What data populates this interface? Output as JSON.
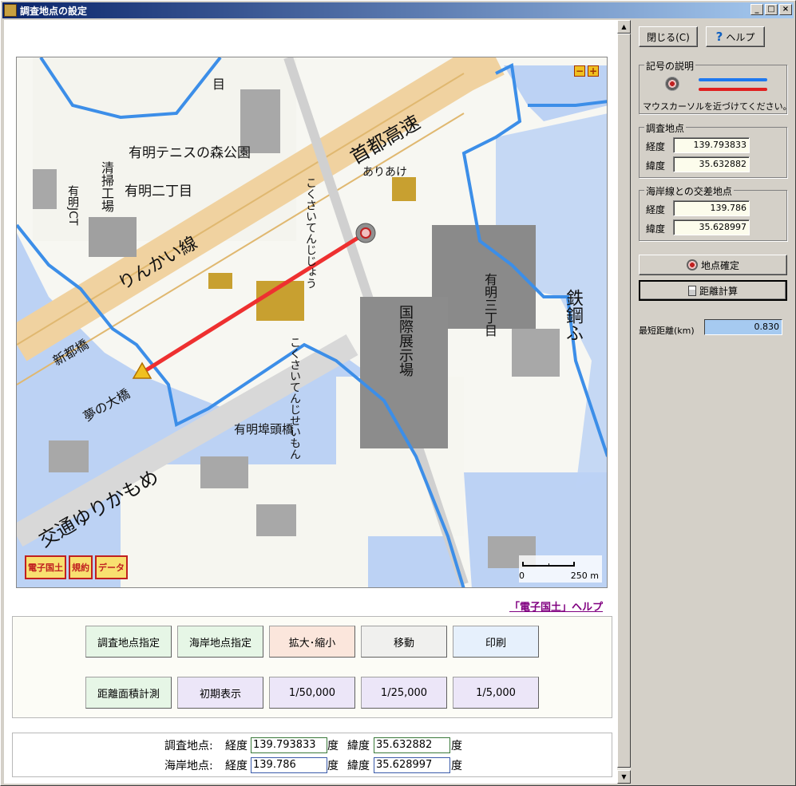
{
  "window": {
    "title": "調査地点の設定",
    "min": "_",
    "max": "□",
    "close": "×"
  },
  "map": {
    "labels": {
      "area1": "有明テニスの森公園",
      "area2": "有明二丁目",
      "area3": "有明三丁目",
      "rail1": "りんかい線",
      "road1": "首都高速",
      "road2": "交通ゆりかもめ",
      "station": "ありあけ",
      "factory": "清掃工場",
      "hall": "国際展示場",
      "bridge1": "新都橋",
      "bridge2": "有明埠頭橋",
      "bridge3": "夢の大橋",
      "kokusai_station": "こくさいてんじじょう",
      "kokusai_seimon": "こくさいてんじせいもん",
      "rail2": "鉄鋼ふ",
      "shi": "有明JCT",
      "chome": "目"
    },
    "zoom_minus": "−",
    "zoom_plus": "+",
    "badges": [
      "電子国土",
      "規約",
      "データ"
    ],
    "scale_zero": "0",
    "scale_label": "250 m"
  },
  "help_link": "「電子国土」ヘルプ",
  "controls": {
    "row1": [
      "調査地点指定",
      "海岸地点指定",
      "拡大･縮小",
      "移動",
      "印刷"
    ],
    "row2": [
      "距離面積計測",
      "初期表示",
      "1/50,000",
      "1/25,000",
      "1/5,000"
    ]
  },
  "coords": {
    "survey_label": "調査地点:",
    "coast_label": "海岸地点:",
    "lon_label": "経度",
    "lat_label": "緯度",
    "unit": "度",
    "survey_lon": "139.793833",
    "survey_lat": "35.632882",
    "coast_lon": "139.786",
    "coast_lat": "35.628997"
  },
  "side": {
    "close_button": "閉じる(C)",
    "help_button": "ヘルプ",
    "legend_title": "記号の説明",
    "legend_hint": "マウスカーソルを近づけてください。",
    "legend_colors": {
      "blue": "#1e78f0",
      "red": "#e02020"
    },
    "survey_group": "調査地点",
    "coast_group": "海岸線との交差地点",
    "lon": "経度",
    "lat": "緯度",
    "survey_lon": "139.793833",
    "survey_lat": "35.632882",
    "coast_lon": "139.786",
    "coast_lat": "35.628997",
    "confirm_button": "地点確定",
    "calc_button": "距離計算",
    "dist_label": "最短距離(km)",
    "dist_value": "0.830"
  }
}
